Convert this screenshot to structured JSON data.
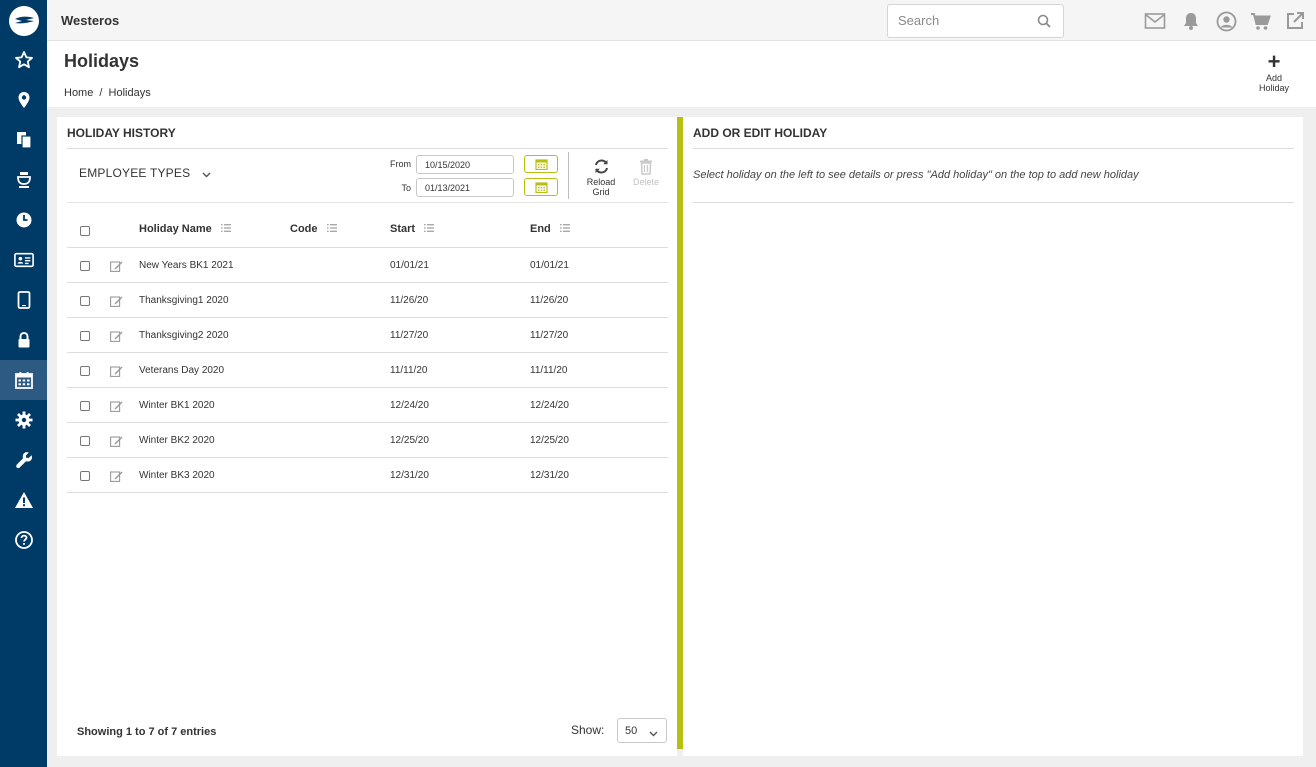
{
  "app": {
    "brand": "Westeros"
  },
  "search": {
    "placeholder": "Search"
  },
  "page": {
    "title": "Holidays",
    "breadcrumb": [
      "Home",
      "/",
      "Holidays"
    ]
  },
  "header_actions": {
    "add_holiday_line1": "Add",
    "add_holiday_line2": "Holiday"
  },
  "sidebar": {
    "items": [
      "star-icon",
      "map-pin-icon",
      "documents-icon",
      "coffee-maker-icon",
      "clock-icon",
      "id-card-icon",
      "tablet-icon",
      "lock-icon",
      "calendar-icon",
      "gear-icon",
      "wrench-icon",
      "warning-icon",
      "help-icon"
    ],
    "active": "calendar-icon"
  },
  "topbar_icons": [
    "mail-icon",
    "bell-icon",
    "user-icon",
    "cart-icon",
    "external-link-icon"
  ],
  "left_panel": {
    "title": "HOLIDAY HISTORY",
    "employee_types": "EMPLOYEE TYPES",
    "from_label": "From",
    "from_value": "10/15/2020",
    "to_label": "To",
    "to_value": "01/13/2021",
    "reload_line1": "Reload",
    "reload_line2": "Grid",
    "delete_label": "Delete",
    "columns": [
      "Holiday Name",
      "Code",
      "Start",
      "End"
    ],
    "rows": [
      {
        "name": "New Years BK1 2021",
        "code": "",
        "start": "01/01/21",
        "end": "01/01/21"
      },
      {
        "name": "Thanksgiving1 2020",
        "code": "",
        "start": "11/26/20",
        "end": "11/26/20"
      },
      {
        "name": "Thanksgiving2 2020",
        "code": "",
        "start": "11/27/20",
        "end": "11/27/20"
      },
      {
        "name": "Veterans Day 2020",
        "code": "",
        "start": "11/11/20",
        "end": "11/11/20"
      },
      {
        "name": "Winter BK1 2020",
        "code": "",
        "start": "12/24/20",
        "end": "12/24/20"
      },
      {
        "name": "Winter BK2 2020",
        "code": "",
        "start": "12/25/20",
        "end": "12/25/20"
      },
      {
        "name": "Winter BK3 2020",
        "code": "",
        "start": "12/31/20",
        "end": "12/31/20"
      }
    ],
    "entries_text": "Showing 1 to 7 of 7 entries",
    "show_label": "Show:",
    "show_value": "50"
  },
  "right_panel": {
    "title": "ADD OR EDIT HOLIDAY",
    "help_text": "Select holiday on the left to see details or press \"Add holiday\" on the top to add new holiday"
  },
  "colors": {
    "sidebar": "#003a66",
    "accent": "#b7bf10",
    "sidebar_active": "#2c5a82"
  }
}
